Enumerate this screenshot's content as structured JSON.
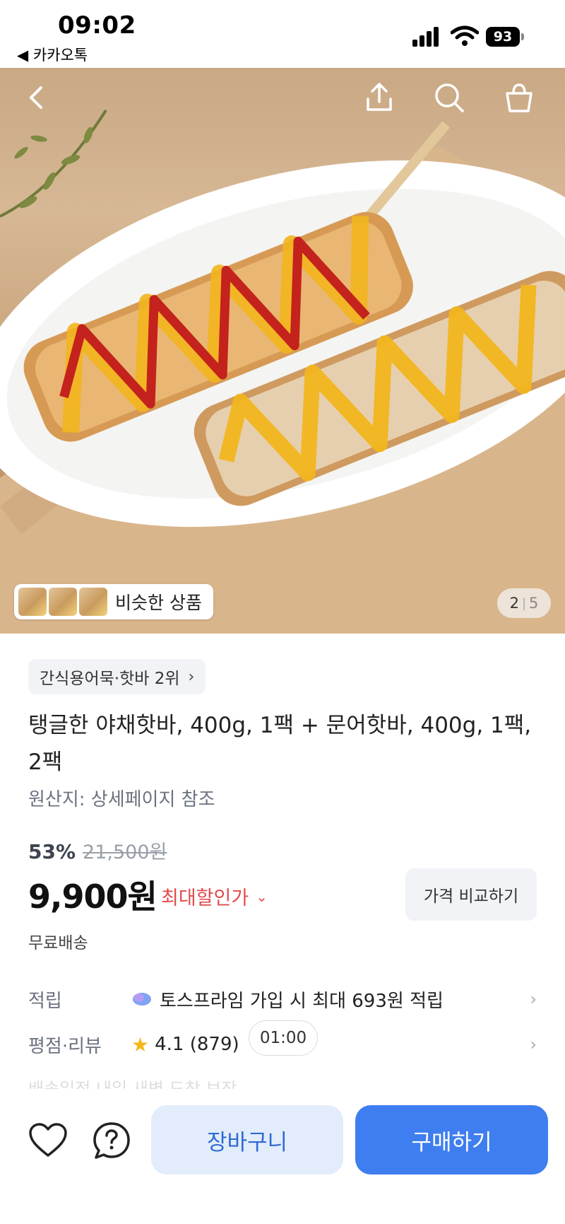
{
  "status_bar": {
    "time": "09:02",
    "back_app": "◀ 카카오톡",
    "battery": "93"
  },
  "hero": {
    "similar_label": "비슷한 상품",
    "page_current": "2",
    "page_total": "5"
  },
  "product": {
    "rank": "간식용어묵·핫바 2위",
    "title": "탱글한 야채핫바, 400g, 1팩 + 문어핫바, 400g, 1팩, 2팩",
    "origin": "원산지: 상세페이지 참조",
    "discount": "53%",
    "original_price": "21,500원",
    "price": "9,900원",
    "max_discount_label": "최대할인가",
    "compare_label": "가격 비교하기",
    "shipping": "무료배송"
  },
  "rows": {
    "points_label": "적립",
    "points_value": "토스프라임 가입 시 최대 693원 적립",
    "rating_label": "평점·리뷰",
    "rating_value": "4.1 (879)",
    "timer": "01:00",
    "faded_text": "배송일정    내일 새벽 도착 보장"
  },
  "bottom_bar": {
    "cart_label": "장바구니",
    "buy_label": "구매하기"
  },
  "colors": {
    "accent": "#3f7ef0",
    "discount_red": "#e34b4b",
    "star": "#f6b71c"
  }
}
